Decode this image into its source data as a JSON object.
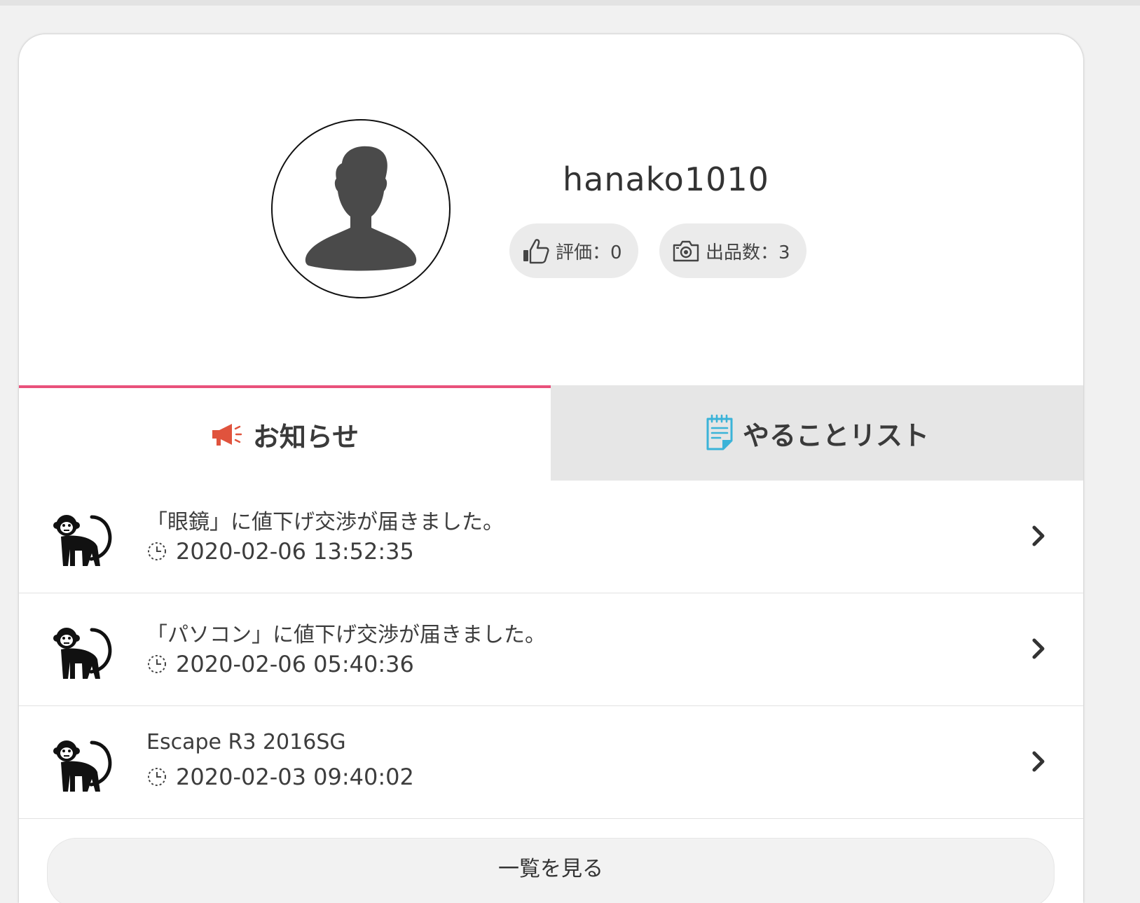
{
  "profile": {
    "username": "hanako1010",
    "rating_label": "評価：0",
    "listings_label": "出品数：3"
  },
  "tabs": [
    {
      "label": "お知らせ",
      "icon": "megaphone-icon",
      "active": true,
      "color": "#e9517b"
    },
    {
      "label": "やることリスト",
      "icon": "notepad-icon",
      "active": false
    }
  ],
  "notifications": [
    {
      "title": "「眼鏡」に値下げ交渉が届きました。",
      "time": "2020-02-06 13:52:35",
      "icon": "monkey-icon"
    },
    {
      "title": "「パソコン」に値下げ交渉が届きました。",
      "time": "2020-02-06 05:40:36",
      "icon": "monkey-icon"
    },
    {
      "title": "Escape R3 2016SG",
      "time": "2020-02-03 09:40:02",
      "icon": "monkey-icon"
    }
  ],
  "more_button_label": "一覧を見る",
  "colors": {
    "accent": "#e9517b",
    "megaphone": "#e0533d",
    "notepad": "#3bb3d8",
    "background": "#f1f1f1"
  }
}
